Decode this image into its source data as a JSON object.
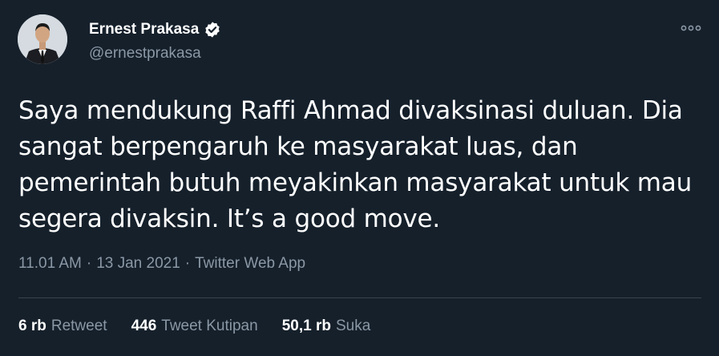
{
  "author": {
    "name": "Ernest Prakasa",
    "handle": "@ernestprakasa",
    "verified": true,
    "avatar_icon": "person-photo"
  },
  "more_icon": "more-horizontal-icon",
  "tweet": {
    "text": "Saya mendukung Raffi Ahmad divaksinasi duluan. Dia sangat berpengaruh ke masyarakat luas, dan pemerintah butuh meyakinkan masyarakat untuk mau segera divaksin. It’s a good move."
  },
  "meta": {
    "time": "11.01 AM",
    "sep1": "·",
    "date": "13 Jan 2021",
    "sep2": "·",
    "source": "Twitter Web App"
  },
  "stats": {
    "retweets": {
      "count": "6 rb",
      "label": "Retweet"
    },
    "quotes": {
      "count": "446",
      "label": "Tweet Kutipan"
    },
    "likes": {
      "count": "50,1 rb",
      "label": "Suka"
    }
  },
  "colors": {
    "background": "#15202b",
    "text": "#ffffff",
    "secondary": "#8b98a5",
    "divider": "#38444d",
    "verified_badge": "#ffffff"
  }
}
